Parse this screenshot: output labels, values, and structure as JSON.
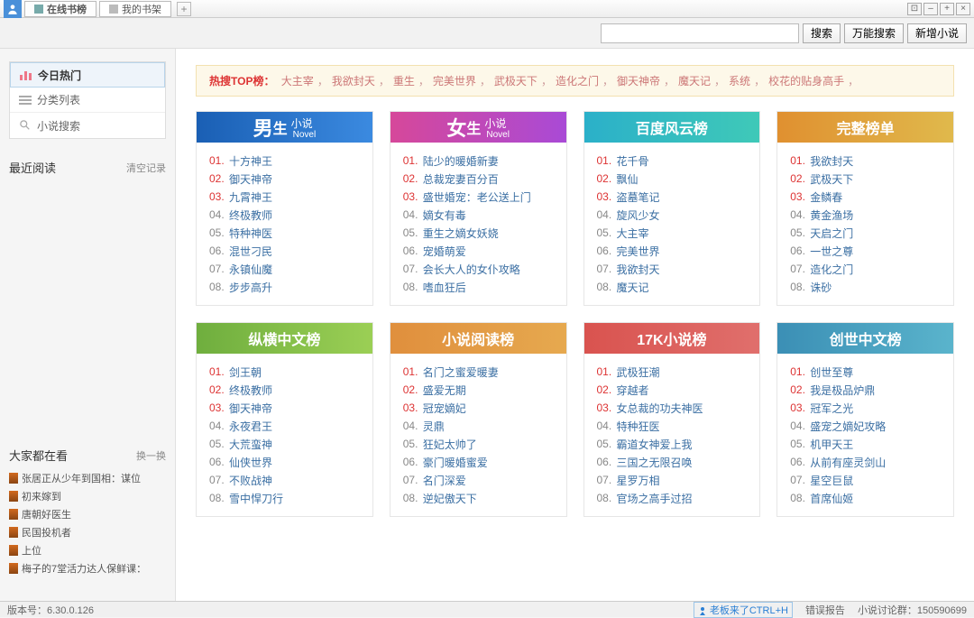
{
  "tabs": {
    "online": "在线书榜",
    "shelf": "我的书架"
  },
  "searchbar": {
    "btn_search": "搜索",
    "btn_power": "万能搜索",
    "btn_add": "新增小说"
  },
  "sidebar": {
    "tabs": {
      "hot": "今日热门",
      "category": "分类列表",
      "search": "小说搜索"
    },
    "recent": {
      "title": "最近阅读",
      "clear": "清空记录"
    },
    "everyone": {
      "title": "大家都在看",
      "swap": "换一换",
      "items": [
        "张居正从少年到国相：谋位",
        "初来嫁到",
        "唐朝好医生",
        "民国投机者",
        "上位",
        "梅子的7堂活力达人保鲜课："
      ]
    }
  },
  "banner": {
    "label": "热搜TOP榜：",
    "links": [
      "大主宰",
      "我欲封天",
      "重生",
      "完美世界",
      "武极天下",
      "造化之门",
      "御天神帝",
      "魔天记",
      "系统",
      "校花的贴身高手"
    ]
  },
  "cards": [
    {
      "cls": "boy",
      "title_big": "男",
      "title_rest": "生",
      "sub": "小说",
      "subE": "Novel",
      "items": [
        "十方神王",
        "御天神帝",
        "九霄神王",
        "终极教师",
        "特种神医",
        "混世刁民",
        "永镇仙魔",
        "步步高升"
      ]
    },
    {
      "cls": "girl",
      "title_big": "女",
      "title_rest": "生",
      "sub": "小说",
      "subE": "Novel",
      "items": [
        "陆少的暖婚新妻",
        "总裁宠妻百分百",
        "盛世婚宠：老公送上门",
        "嫡女有毒",
        "重生之嫡女妖娆",
        "宠婚萌爱",
        "会长大人的女仆攻略",
        "嗜血狂后"
      ]
    },
    {
      "cls": "baidu",
      "title": "百度风云榜",
      "items": [
        "花千骨",
        "飘仙",
        "盗墓笔记",
        "旋风少女",
        "大主宰",
        "完美世界",
        "我欲封天",
        "魔天记"
      ]
    },
    {
      "cls": "full",
      "title": "完整榜单",
      "items": [
        "我欲封天",
        "武极天下",
        "金鳞春",
        "黄金渔场",
        "天启之门",
        "一世之尊",
        "造化之门",
        "诛砂"
      ]
    },
    {
      "cls": "zh",
      "title": "纵横中文榜",
      "items": [
        "剑王朝",
        "终极教师",
        "御天神帝",
        "永夜君王",
        "大荒蛮神",
        "仙侠世界",
        "不败战神",
        "雪中悍刀行"
      ]
    },
    {
      "cls": "read",
      "title": "小说阅读榜",
      "items": [
        "名门之蜜爱暖妻",
        "盛爱无期",
        "冠宠嫡妃",
        "灵鼎",
        "狂妃太帅了",
        "豪门暖婚蜜爱",
        "名门深爱",
        "逆妃傲天下"
      ]
    },
    {
      "cls": "k17",
      "title": "17K小说榜",
      "items": [
        "武极狂潮",
        "穿越者",
        "女总裁的功夫神医",
        "特种狂医",
        "霸道女神爱上我",
        "三国之无限召唤",
        "星罗万相",
        "官场之高手过招"
      ]
    },
    {
      "cls": "cs",
      "title": "创世中文榜",
      "items": [
        "创世至尊",
        "我是极品炉鼎",
        "冠军之光",
        "盛宠之嫡妃攻略",
        "机甲天王",
        "从前有座灵剑山",
        "星空巨鼠",
        "首席仙姬"
      ]
    }
  ],
  "footer": {
    "version": "版本号：6.30.0.126",
    "boss": "老板来了CTRL+H",
    "error": "错误报告",
    "group": "小说讨论群：150590699"
  }
}
